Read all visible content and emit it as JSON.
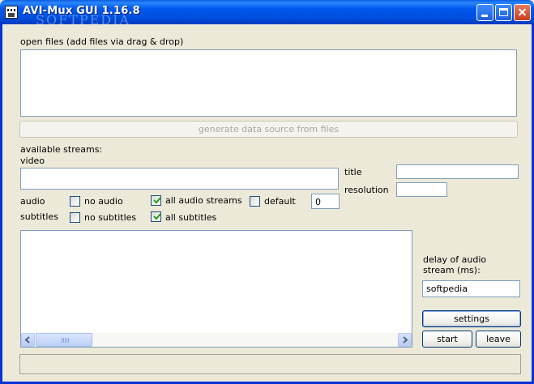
{
  "window": {
    "title": "AVI-Mux GUI 1.16.8",
    "watermark": "SOFTPEDIA"
  },
  "open_files": {
    "label": "open files (add files via drag & drop)",
    "generate_button": "generate data source from files"
  },
  "streams": {
    "available_label": "available streams:",
    "video_label": "video",
    "audio_label": "audio",
    "subtitles_label": "subtitles",
    "no_audio_label": "no audio",
    "no_audio_checked": false,
    "all_audio_label": "all audio streams",
    "all_audio_checked": true,
    "default_label": "default",
    "default_checked": false,
    "default_value": "0",
    "no_subtitles_label": "no subtitles",
    "no_subtitles_checked": false,
    "all_subtitles_label": "all subtitles",
    "all_subtitles_checked": true
  },
  "properties": {
    "title_label": "title",
    "title_value": "",
    "resolution_label": "resolution",
    "resolution_value": ""
  },
  "audio_delay": {
    "label": "delay of audio stream (ms):",
    "value": "softpedia"
  },
  "actions": {
    "settings": "settings",
    "start": "start",
    "leave": "leave"
  },
  "icons": {
    "app": "film-icon",
    "minimize": "minimize-icon",
    "maximize": "maximize-icon",
    "close": "close-icon",
    "scroll_left": "arrow-left-icon",
    "scroll_right": "arrow-right-icon"
  },
  "colors": {
    "titlebar": "#0058ee",
    "window_bg": "#ece9d8",
    "field_border": "#7f9db9",
    "disabled_text": "#a9a89d"
  }
}
